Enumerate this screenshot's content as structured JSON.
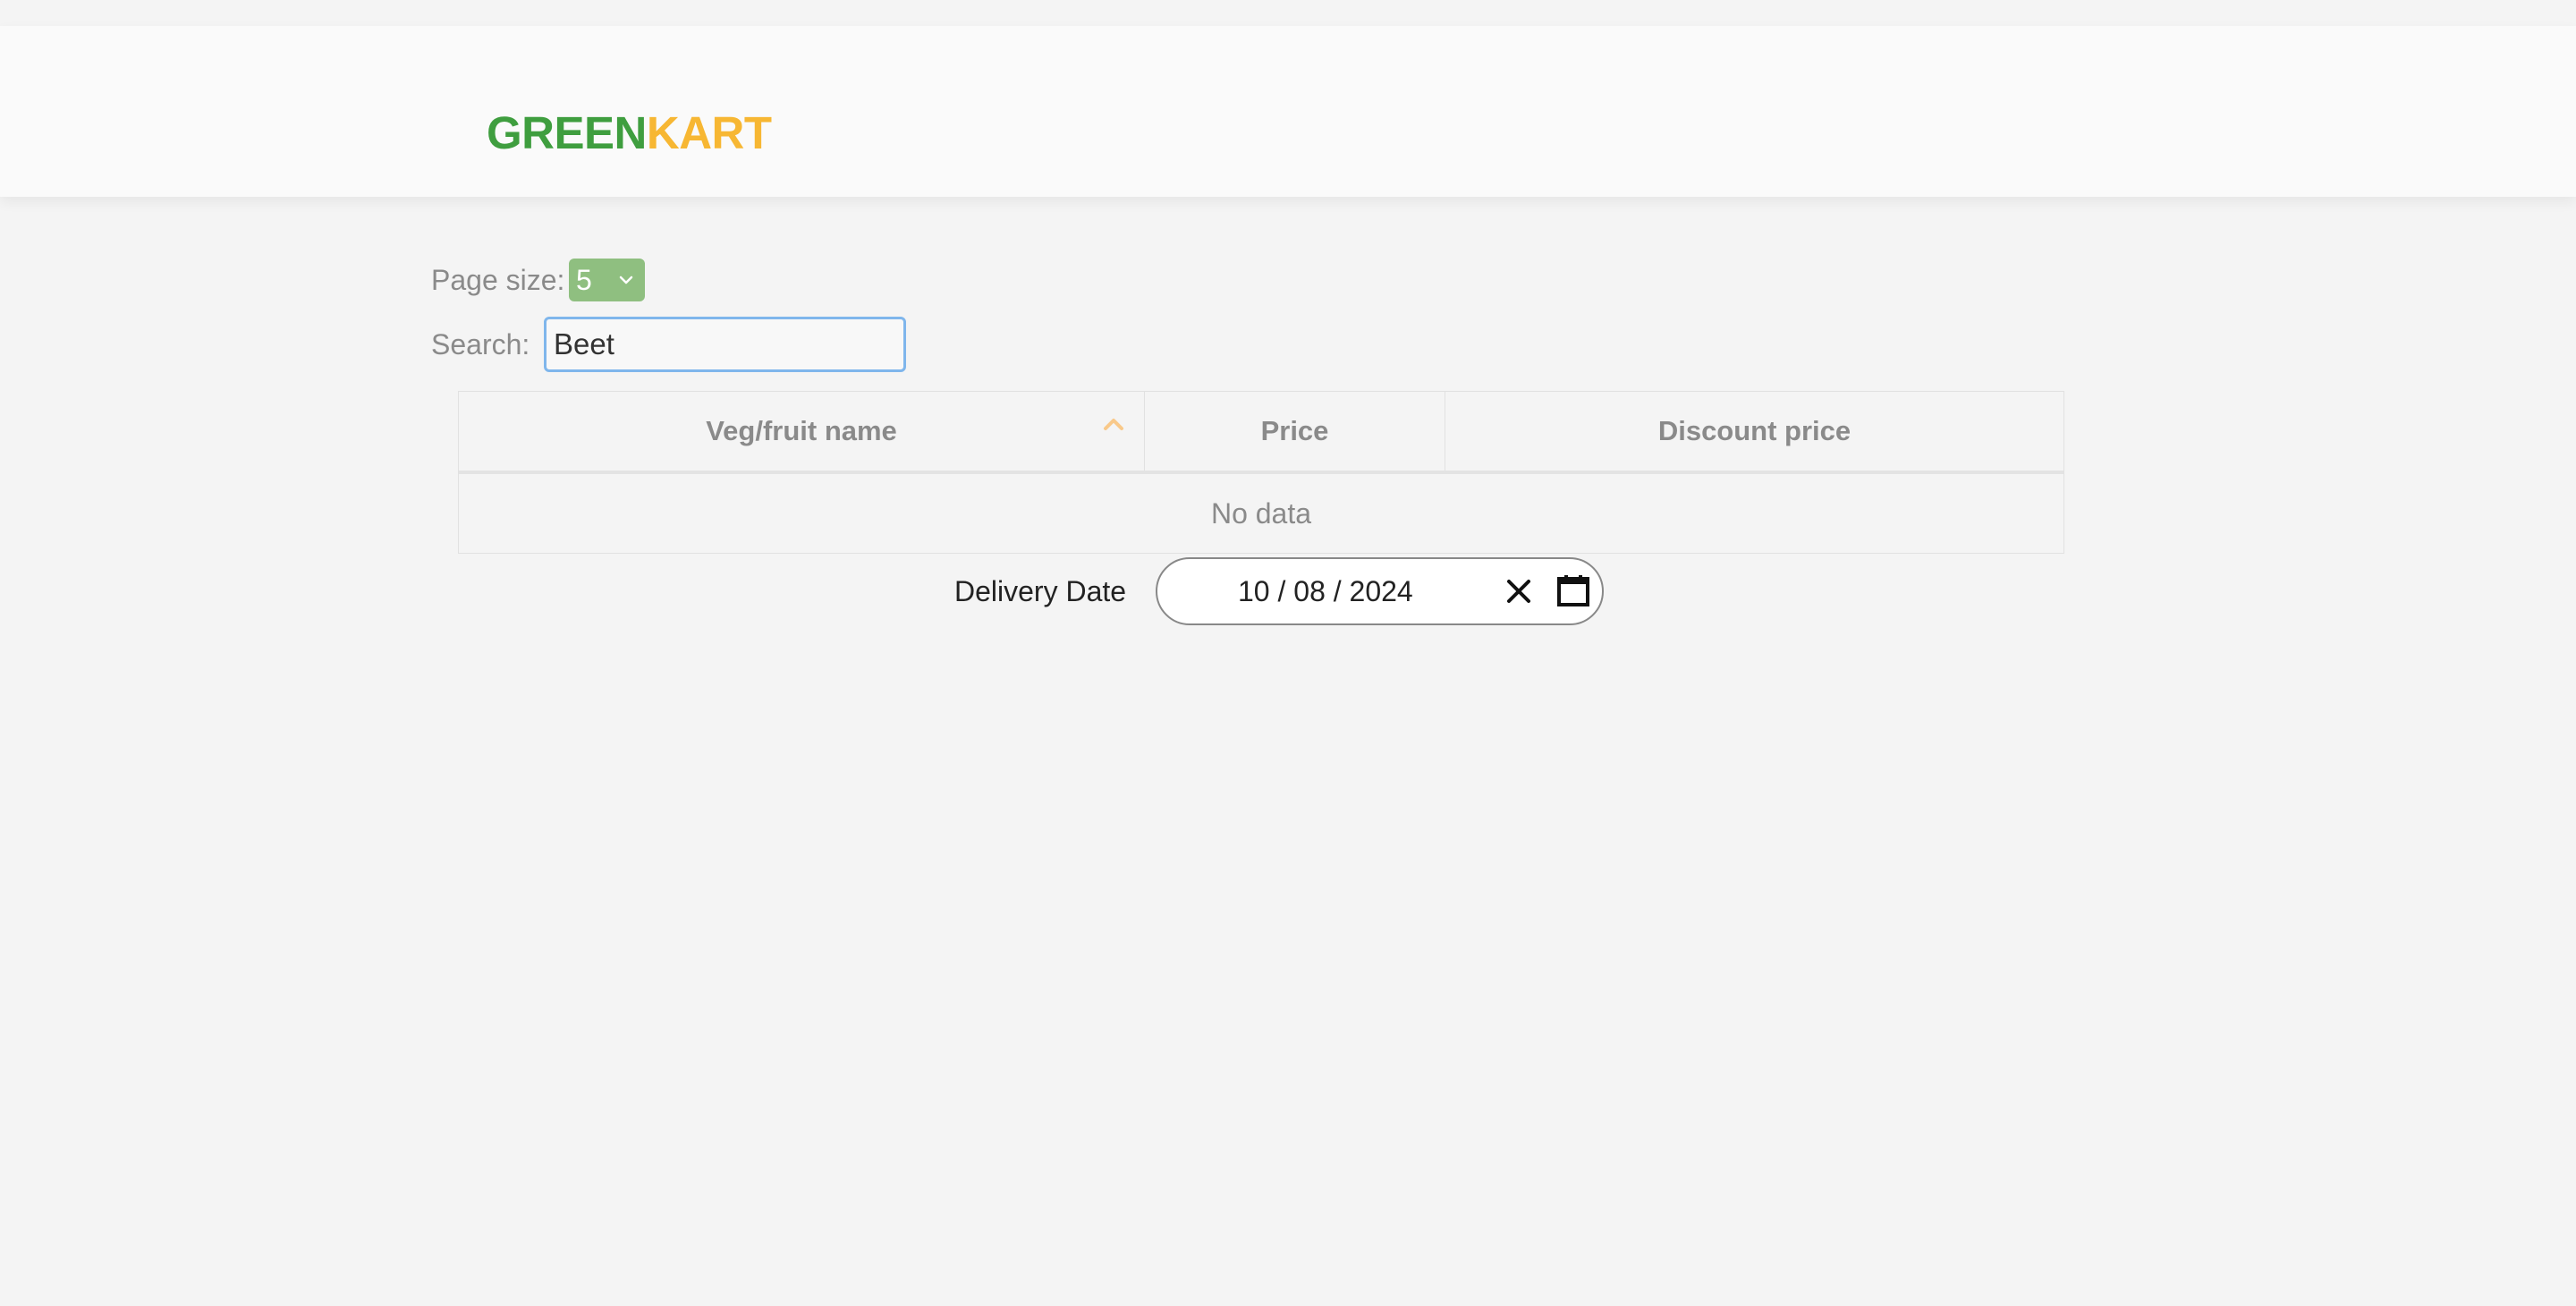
{
  "brand": {
    "green": "GREEN",
    "orange": "KART"
  },
  "controls": {
    "page_size_label": "Page size:",
    "page_size_value": "5",
    "search_label": "Search:",
    "search_value": "Beet"
  },
  "table": {
    "columns": [
      "Veg/fruit name",
      "Price",
      "Discount price"
    ],
    "sorted_column": "Veg/fruit name",
    "sort_direction": "ascending",
    "empty_text": "No data"
  },
  "delivery": {
    "label": "Delivery Date",
    "date": "10 / 08 / 2024"
  },
  "colors": {
    "brand_green": "#3f9e3f",
    "brand_orange": "#f7b733",
    "select_bg": "#8fbf80",
    "focus_border": "#7fb6ec",
    "sort_arrow": "#f9c98a"
  },
  "icons": [
    "chevron-down-icon",
    "sort-ascending-icon",
    "close-icon",
    "calendar-icon"
  ]
}
